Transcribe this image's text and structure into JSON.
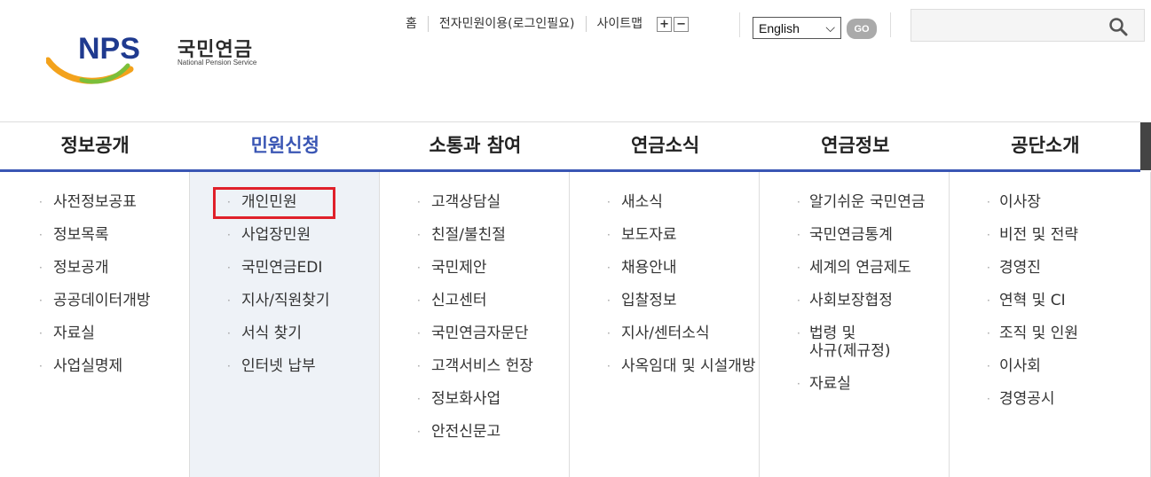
{
  "logo": {
    "letters": "NPS",
    "korean": "국민연금",
    "english": "National Pension Service"
  },
  "util": {
    "home": "홈",
    "eservice": "전자민원이용(로그인필요)",
    "sitemap": "사이트맵",
    "zoom_in": "+",
    "zoom_out": "−",
    "language": "English",
    "go": "GO"
  },
  "search": {
    "placeholder": ""
  },
  "menu": [
    {
      "label": "정보공개",
      "items": [
        "사전정보공표",
        "정보목록",
        "정보공개",
        "공공데이터개방",
        "자료실",
        "사업실명제"
      ]
    },
    {
      "label": "민원신청",
      "items": [
        "개인민원",
        "사업장민원",
        "국민연금EDI",
        "지사/직원찾기",
        "서식 찾기",
        "인터넷 납부"
      ]
    },
    {
      "label": "소통과 참여",
      "items": [
        "고객상담실",
        "친절/불친절",
        "국민제안",
        "신고센터",
        "국민연금자문단",
        "고객서비스 헌장",
        "정보화사업",
        "안전신문고"
      ]
    },
    {
      "label": "연금소식",
      "items": [
        "새소식",
        "보도자료",
        "채용안내",
        "입찰정보",
        "지사/센터소식",
        "사옥임대 및 시설개방"
      ]
    },
    {
      "label": "연금정보",
      "items": [
        "알기쉬운 국민연금",
        "국민연금통계",
        "세계의 연금제도",
        "사회보장협정",
        "법령 및\n사규(제규정)",
        "자료실"
      ]
    },
    {
      "label": "공단소개",
      "items": [
        "이사장",
        "비전 및 전략",
        "경영진",
        "연혁 및 CI",
        "조직 및 인원",
        "이사회",
        "경영공시"
      ]
    }
  ],
  "colors": {
    "accent": "#3a56b4",
    "highlight": "#e0202a"
  }
}
